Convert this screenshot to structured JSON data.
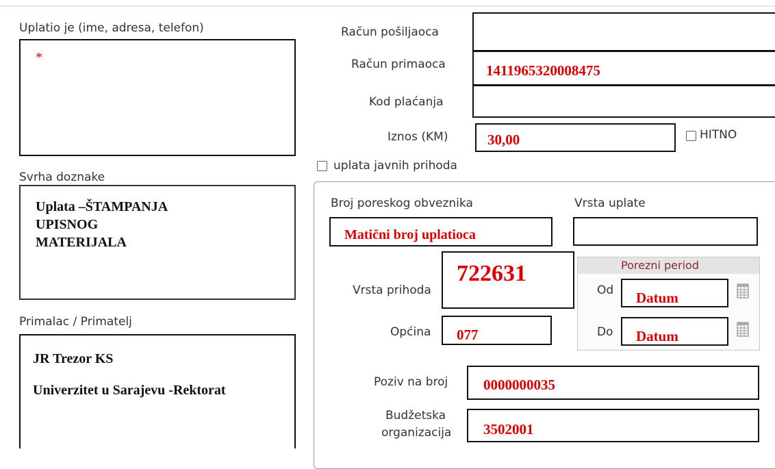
{
  "payer": {
    "label": "Uplatio je (ime, adresa, telefon)",
    "marker": "*"
  },
  "purpose": {
    "label": "Svrha doznake",
    "lines": [
      "Uplata –ŠTAMPANJA",
      "UPISNOG",
      "MATERIJALA"
    ]
  },
  "recipient": {
    "label": "Primalac / Primatelj",
    "line1": "JR Trezor KS",
    "line2": "Univerzitet u Sarajevu -Rektorat"
  },
  "sender_account": {
    "label": "Račun pošiljaoca",
    "value": ""
  },
  "recipient_account": {
    "label": "Račun primaoca",
    "value": "1411965320008475"
  },
  "payment_code": {
    "label": "Kod plaćanja",
    "value": ""
  },
  "amount": {
    "label": "Iznos (KM)",
    "value": "30,00"
  },
  "urgent": {
    "label": "HITNO",
    "checked": false
  },
  "public_revenue": {
    "label": "uplata javnih prihoda",
    "checked": false
  },
  "tax_payer_number": {
    "label": "Broj poreskog obveznika",
    "value": "Matični broj uplatioca"
  },
  "payment_type": {
    "label": "Vrsta uplate",
    "value": ""
  },
  "revenue_type": {
    "label": "Vrsta prihoda",
    "value": "722631"
  },
  "municipality": {
    "label": "Općina",
    "value": "077"
  },
  "tax_period": {
    "title": "Porezni period",
    "from_label": "Od",
    "from_value": "Datum",
    "to_label": "Do",
    "to_value": "Datum"
  },
  "reference_number": {
    "label": "Poziv na broj",
    "value": "0000000035"
  },
  "budget_org": {
    "label_line1": "Budžetska",
    "label_line2": "organizacija",
    "value": "3502001"
  },
  "colors": {
    "value_red": "#e00000",
    "section_title": "#8b2a2a",
    "border": "#111111"
  }
}
